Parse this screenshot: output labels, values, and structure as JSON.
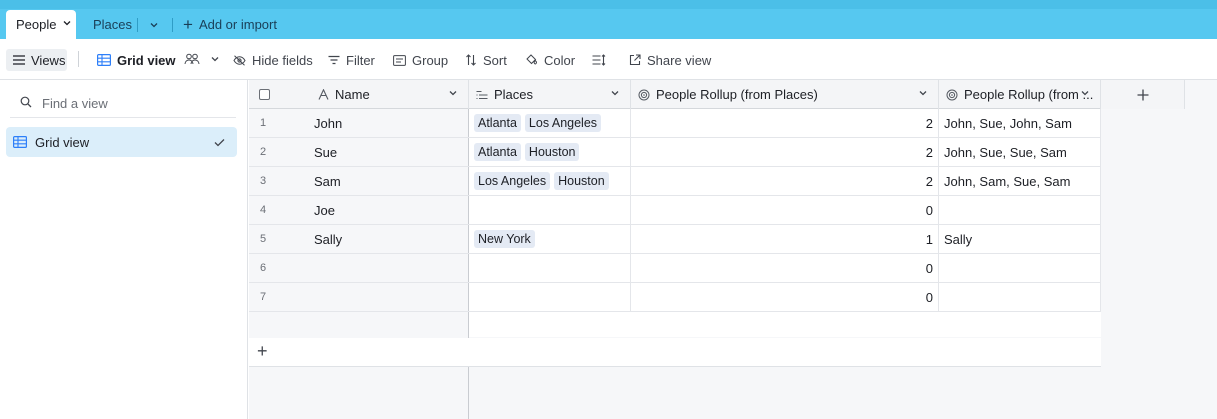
{
  "tabs": {
    "active_label": "People",
    "second_label": "Places",
    "add_label": "Add or import"
  },
  "toolbar": {
    "views_label": "Views",
    "gridview_label": "Grid view",
    "hide_fields_label": "Hide fields",
    "filter_label": "Filter",
    "group_label": "Group",
    "sort_label": "Sort",
    "color_label": "Color",
    "share_label": "Share view"
  },
  "sidebar": {
    "search_placeholder": "Find a view",
    "items": [
      {
        "label": "Grid view"
      }
    ]
  },
  "grid": {
    "columns": [
      {
        "label": "Name",
        "icon": "text-field-icon"
      },
      {
        "label": "Places",
        "icon": "linked-record-icon"
      },
      {
        "label": "People Rollup (from Places)",
        "icon": "rollup-icon"
      },
      {
        "label": "People Rollup (from ...",
        "icon": "rollup-icon"
      }
    ],
    "rows": [
      {
        "num": "1",
        "name": "John",
        "places": [
          "Atlanta",
          "Los Angeles"
        ],
        "count": "2",
        "rollup": "John, Sue, John, Sam"
      },
      {
        "num": "2",
        "name": "Sue",
        "places": [
          "Atlanta",
          "Houston"
        ],
        "count": "2",
        "rollup": "John, Sue, Sue, Sam"
      },
      {
        "num": "3",
        "name": "Sam",
        "places": [
          "Los Angeles",
          "Houston"
        ],
        "count": "2",
        "rollup": "John, Sam, Sue, Sam"
      },
      {
        "num": "4",
        "name": "Joe",
        "places": [],
        "count": "0",
        "rollup": ""
      },
      {
        "num": "5",
        "name": "Sally",
        "places": [
          "New York"
        ],
        "count": "1",
        "rollup": "Sally"
      },
      {
        "num": "6",
        "name": "",
        "places": [],
        "count": "0",
        "rollup": ""
      },
      {
        "num": "7",
        "name": "",
        "places": [],
        "count": "0",
        "rollup": ""
      }
    ]
  },
  "colors": {
    "tab_bar": "#56c8f0",
    "selected_view": "#dbeefa",
    "chip": "#e4eaf4"
  }
}
